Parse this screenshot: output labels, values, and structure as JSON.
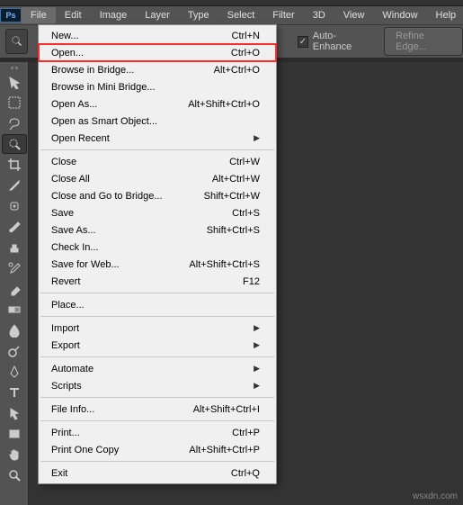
{
  "app": {
    "logo": "Ps",
    "watermark": "wsxdn.com"
  },
  "menubar": {
    "items": [
      "File",
      "Edit",
      "Image",
      "Layer",
      "Type",
      "Select",
      "Filter",
      "3D",
      "View",
      "Window",
      "Help"
    ],
    "active_index": 0
  },
  "options_bar": {
    "auto_enhance_label": "Auto-Enhance",
    "auto_enhance_checked": true,
    "refine_edge_label": "Refine Edge..."
  },
  "toolbar": {
    "tools": [
      "move-tool",
      "marquee-tool",
      "lasso-tool",
      "quick-selection-tool",
      "crop-tool",
      "eyedropper-tool",
      "healing-brush-tool",
      "brush-tool",
      "clone-stamp-tool",
      "history-brush-tool",
      "eraser-tool",
      "gradient-tool",
      "blur-tool",
      "dodge-tool",
      "pen-tool",
      "type-tool",
      "path-selection-tool",
      "rectangle-tool",
      "hand-tool",
      "zoom-tool"
    ],
    "selected": "quick-selection-tool"
  },
  "file_menu": {
    "highlighted_index": 1,
    "groups": [
      [
        {
          "label": "New...",
          "shortcut": "Ctrl+N"
        },
        {
          "label": "Open...",
          "shortcut": "Ctrl+O"
        },
        {
          "label": "Browse in Bridge...",
          "shortcut": "Alt+Ctrl+O"
        },
        {
          "label": "Browse in Mini Bridge..."
        },
        {
          "label": "Open As...",
          "shortcut": "Alt+Shift+Ctrl+O"
        },
        {
          "label": "Open as Smart Object..."
        },
        {
          "label": "Open Recent",
          "submenu": true
        }
      ],
      [
        {
          "label": "Close",
          "shortcut": "Ctrl+W"
        },
        {
          "label": "Close All",
          "shortcut": "Alt+Ctrl+W"
        },
        {
          "label": "Close and Go to Bridge...",
          "shortcut": "Shift+Ctrl+W"
        },
        {
          "label": "Save",
          "shortcut": "Ctrl+S"
        },
        {
          "label": "Save As...",
          "shortcut": "Shift+Ctrl+S"
        },
        {
          "label": "Check In..."
        },
        {
          "label": "Save for Web...",
          "shortcut": "Alt+Shift+Ctrl+S"
        },
        {
          "label": "Revert",
          "shortcut": "F12"
        }
      ],
      [
        {
          "label": "Place..."
        }
      ],
      [
        {
          "label": "Import",
          "submenu": true
        },
        {
          "label": "Export",
          "submenu": true
        }
      ],
      [
        {
          "label": "Automate",
          "submenu": true
        },
        {
          "label": "Scripts",
          "submenu": true
        }
      ],
      [
        {
          "label": "File Info...",
          "shortcut": "Alt+Shift+Ctrl+I"
        }
      ],
      [
        {
          "label": "Print...",
          "shortcut": "Ctrl+P"
        },
        {
          "label": "Print One Copy",
          "shortcut": "Alt+Shift+Ctrl+P"
        }
      ],
      [
        {
          "label": "Exit",
          "shortcut": "Ctrl+Q"
        }
      ]
    ]
  }
}
